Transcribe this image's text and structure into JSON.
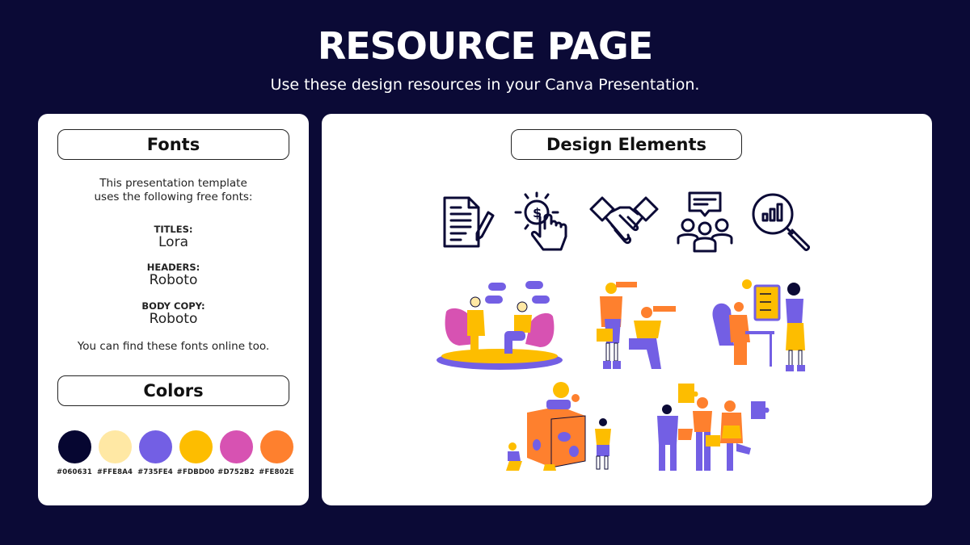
{
  "header": {
    "title": "RESOURCE PAGE",
    "subtitle": "Use these design resources in your Canva Presentation."
  },
  "fonts_panel": {
    "heading": "Fonts",
    "intro_line1": "This presentation template",
    "intro_line2": "uses the following free fonts:",
    "entries": [
      {
        "label": "TITLES:",
        "font": "Lora"
      },
      {
        "label": "HEADERS:",
        "font": "Roboto"
      },
      {
        "label": "BODY COPY:",
        "font": "Roboto"
      }
    ],
    "footer": "You can find these fonts online too."
  },
  "colors_panel": {
    "heading": "Colors",
    "swatches": [
      {
        "hex": "#060631",
        "label": "#060631"
      },
      {
        "hex": "#FFE8A4",
        "label": "#FFE8A4"
      },
      {
        "hex": "#735FE4",
        "label": "#735FE4"
      },
      {
        "hex": "#FDBD00",
        "label": "#FDBD00"
      },
      {
        "hex": "#D752B2",
        "label": "#D752B2"
      },
      {
        "hex": "#FE802E",
        "label": "#FE802E"
      }
    ]
  },
  "design_panel": {
    "heading": "Design Elements",
    "icons": [
      "contract-icon",
      "payment-click-icon",
      "handshake-icon",
      "team-discussion-icon",
      "analytics-search-icon"
    ],
    "illustrations": [
      "interview-illustration",
      "explorers-illustration",
      "office-work-illustration",
      "teamwork-cube-illustration",
      "puzzle-team-illustration"
    ]
  }
}
